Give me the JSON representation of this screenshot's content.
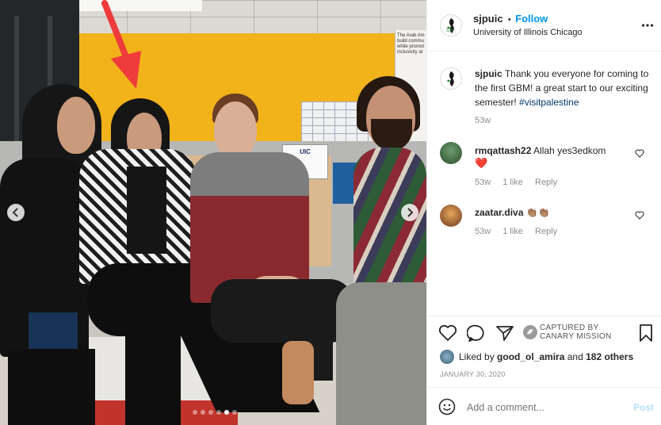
{
  "post": {
    "username": "sjpuic",
    "follow_label": "Follow",
    "dot": "•",
    "location": "University of Illinois Chicago",
    "more_icon": "more-horizontal-icon"
  },
  "photo": {
    "sign_text": "UIC",
    "poster_text": "The Arab Am build commu while promot inclusivity at",
    "carousel": {
      "total": 6,
      "active": 5
    }
  },
  "caption": {
    "username": "sjpuic",
    "text": "Thank you everyone for coming to the first GBM! a great start to our exciting semester! ",
    "hashtag": "#visitpalestine",
    "time": "53w"
  },
  "comments": [
    {
      "username": "rmqattash22",
      "text": "Allah yes3edkom",
      "emoji": "❤️",
      "time": "53w",
      "likes": "1 like",
      "reply": "Reply"
    },
    {
      "username": "zaatar.diva",
      "text": "👏🏽👏🏽",
      "time": "53w",
      "likes": "1 like",
      "reply": "Reply"
    }
  ],
  "actions": {
    "captured_line1": "CAPTURED BY",
    "captured_line2": "CANARY MISSION",
    "liked_prefix": "Liked by ",
    "liked_user": "good_ol_amira",
    "liked_and": " and ",
    "liked_count": "182 others",
    "date": "JANUARY 30, 2020"
  },
  "add_comment": {
    "placeholder": "Add a comment...",
    "post_label": "Post"
  },
  "colors": {
    "link": "#0095f6",
    "muted": "#8e8e8e",
    "heart": "#ed4956",
    "arrow": "#ee3b3b",
    "wall": "#f1b21a"
  }
}
